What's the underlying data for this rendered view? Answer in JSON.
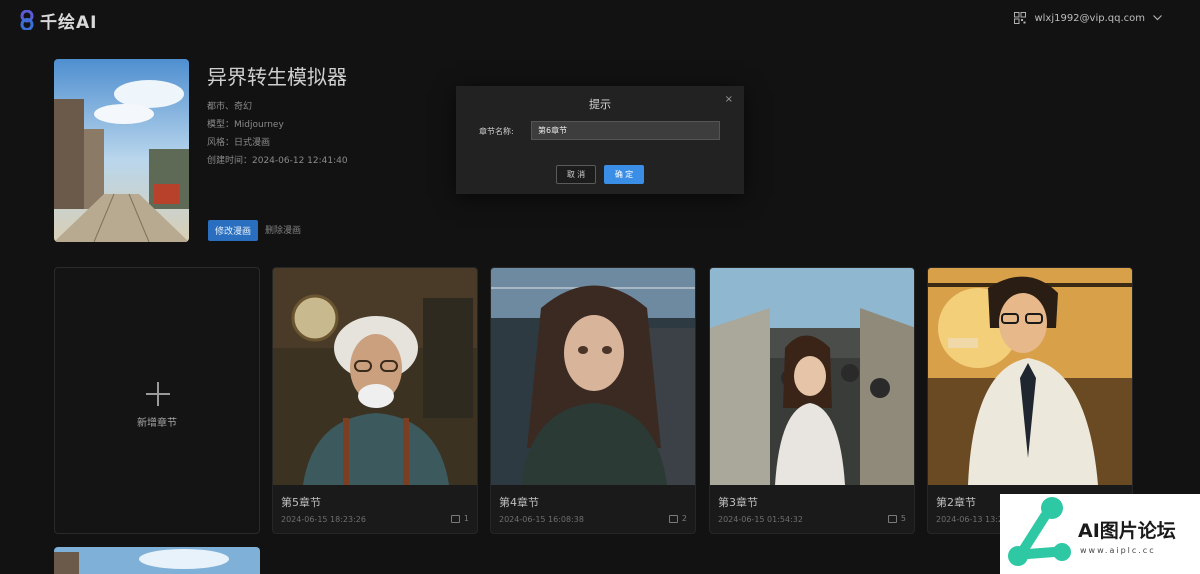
{
  "header": {
    "logo_text": "千绘AI",
    "user_email": "wlxj1992@vip.qq.com"
  },
  "project": {
    "title": "异界转生模拟器",
    "tags": "都市、奇幻",
    "model": "模型：Midjourney",
    "style": "风格：日式漫画",
    "created": "创建时间：2024-06-12 12:41:40",
    "edit_label": "修改漫画",
    "delete_label": "删除漫画"
  },
  "add_chapter": {
    "label": "新增章节"
  },
  "chapters": [
    {
      "title": "第5章节",
      "date": "2024-06-15 18:23:26",
      "count": "1"
    },
    {
      "title": "第4章节",
      "date": "2024-06-15 16:08:38",
      "count": "2"
    },
    {
      "title": "第3章节",
      "date": "2024-06-15 01:54:32",
      "count": "5"
    },
    {
      "title": "第2章节",
      "date": "2024-06-13 13:2",
      "count": ""
    }
  ],
  "modal": {
    "title": "提示",
    "close": "×",
    "field_label": "章节名称:",
    "field_value": "第6章节",
    "cancel_label": "取 消",
    "ok_label": "确 定"
  },
  "watermark": {
    "text": "AI图片论坛",
    "url": "www.aiplc.cc"
  }
}
